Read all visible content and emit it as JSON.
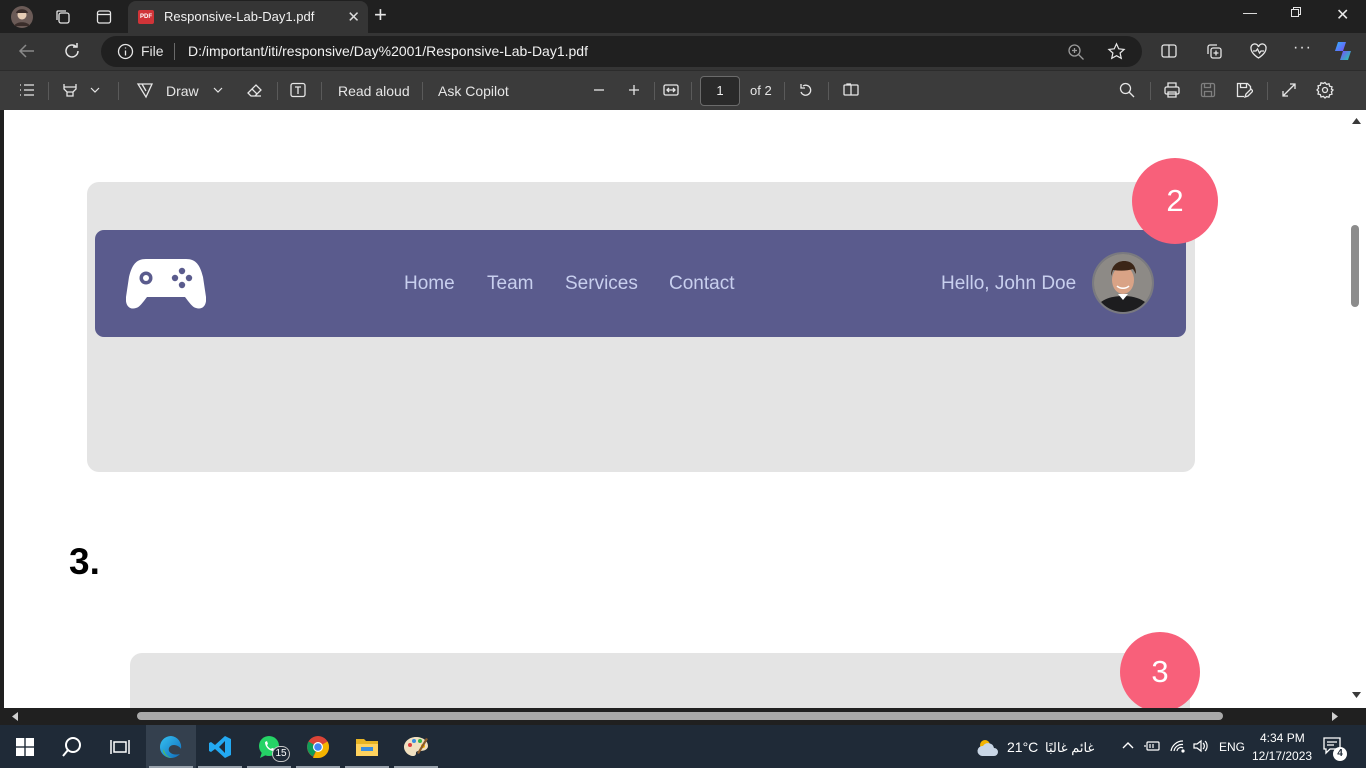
{
  "browser": {
    "tab_title": "Responsive-Lab-Day1.pdf",
    "tab_badge": "PDF",
    "address_scheme": "File",
    "address_url": "D:/important/iti/responsive/Day%2001/Responsive-Lab-Day1.pdf"
  },
  "pdf_toolbar": {
    "draw": "Draw",
    "read_aloud": "Read aloud",
    "ask_copilot": "Ask Copilot",
    "page_number": "1",
    "page_total": "of 2"
  },
  "document": {
    "card2": {
      "badge": "2",
      "nav_links": [
        "Home",
        "Team",
        "Services",
        "Contact"
      ],
      "greeting": "Hello, John Doe",
      "navbar_color": "#5a5b8d",
      "badge_color": "#f8607a"
    },
    "heading": "3.",
    "card3": {
      "badge": "3"
    }
  },
  "taskbar": {
    "whatsapp_count": "15",
    "weather": "21°C",
    "weather_text": "غائم غالبًا",
    "language": "ENG",
    "time": "4:34 PM",
    "date": "12/17/2023",
    "notifications": "4"
  }
}
